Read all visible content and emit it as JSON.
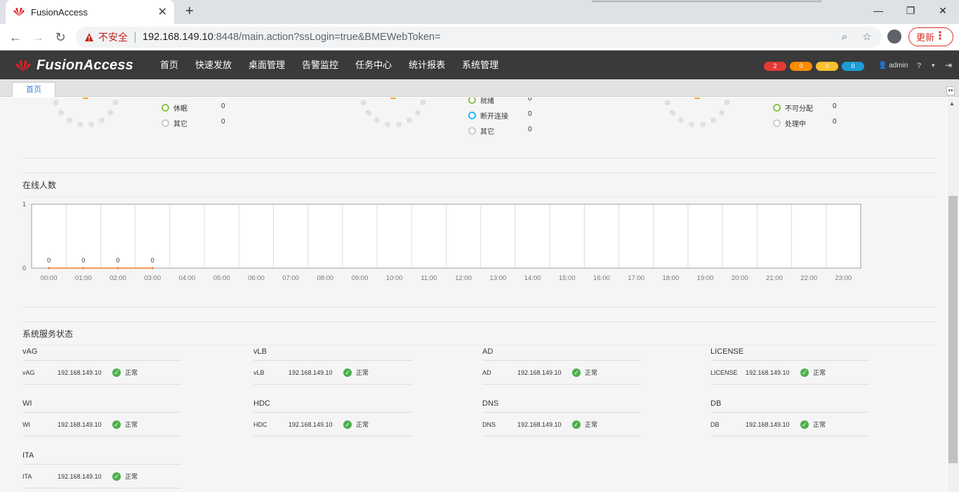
{
  "browser": {
    "tab_title": "FusionAccess",
    "security_label": "不安全",
    "url_host": "192.168.149.10",
    "url_path": ":8448/main.action?ssLogin=true&BMEWebToken=",
    "update_label": "更新"
  },
  "app": {
    "logo": "FusionAccess",
    "menu": [
      "首页",
      "快速发放",
      "桌面管理",
      "告警监控",
      "任务中心",
      "统计报表",
      "系统管理"
    ],
    "alarms": [
      {
        "count": "2",
        "color": "#e53935"
      },
      {
        "count": "0",
        "color": "#fb8c00"
      },
      {
        "count": "0",
        "color": "#fbc02d"
      },
      {
        "count": "0",
        "color": "#1e9bd7"
      }
    ],
    "user": "admin",
    "help": "?",
    "subtab": "首页"
  },
  "summary": {
    "col1": [
      {
        "label": "休眠",
        "value": "0",
        "color": "#8bc34a"
      },
      {
        "label": "其它",
        "value": "0",
        "color": "#cccccc"
      }
    ],
    "col2": [
      {
        "label": "就绪",
        "value": "0",
        "color": "#8bc34a"
      },
      {
        "label": "断开连接",
        "value": "0",
        "color": "#29b6f6"
      },
      {
        "label": "其它",
        "value": "0",
        "color": "#cccccc"
      }
    ],
    "col3": [
      {
        "label": "不可分配",
        "value": "0",
        "color": "#8bc34a"
      },
      {
        "label": "处理中",
        "value": "0",
        "color": "#cccccc"
      }
    ]
  },
  "online": {
    "title": "在线人数"
  },
  "chart_data": {
    "type": "line",
    "x": [
      "00:00",
      "01:00",
      "02:00",
      "03:00",
      "04:00",
      "05:00",
      "06:00",
      "07:00",
      "08:00",
      "09:00",
      "10:00",
      "11:00",
      "12:00",
      "13:00",
      "14:00",
      "15:00",
      "16:00",
      "17:00",
      "18:00",
      "19:00",
      "20:00",
      "21:00",
      "22:00",
      "23:00"
    ],
    "series": [
      {
        "values": [
          0,
          0,
          0,
          0
        ]
      }
    ],
    "data_labels": [
      "0",
      "0",
      "0",
      "0"
    ],
    "ylim": [
      0,
      1
    ],
    "yticks": [
      "0",
      "1"
    ],
    "grid": true,
    "line_color": "#f07c2b"
  },
  "services": {
    "title": "系统服务状态",
    "groups": [
      {
        "name": "vAG",
        "rows": [
          {
            "type": "vAG",
            "ip": "192.168.149.10",
            "status": "正常"
          }
        ]
      },
      {
        "name": "vLB",
        "rows": [
          {
            "type": "vLB",
            "ip": "192.168.149.10",
            "status": "正常"
          }
        ]
      },
      {
        "name": "AD",
        "rows": [
          {
            "type": "AD",
            "ip": "192.168.149.10",
            "status": "正常"
          }
        ]
      },
      {
        "name": "LICENSE",
        "rows": [
          {
            "type": "LICENSE",
            "ip": "192.168.149.10",
            "status": "正常"
          }
        ]
      },
      {
        "name": "WI",
        "rows": [
          {
            "type": "WI",
            "ip": "192.168.149.10",
            "status": "正常"
          }
        ]
      },
      {
        "name": "HDC",
        "rows": [
          {
            "type": "HDC",
            "ip": "192.168.149.10",
            "status": "正常"
          }
        ]
      },
      {
        "name": "DNS",
        "rows": [
          {
            "type": "DNS",
            "ip": "192.168.149.10",
            "status": "正常"
          }
        ]
      },
      {
        "name": "DB",
        "rows": [
          {
            "type": "DB",
            "ip": "192.168.149.10",
            "status": "正常"
          }
        ]
      },
      {
        "name": "ITA",
        "rows": [
          {
            "type": "ITA",
            "ip": "192.168.149.10",
            "status": "正常"
          }
        ]
      }
    ]
  }
}
